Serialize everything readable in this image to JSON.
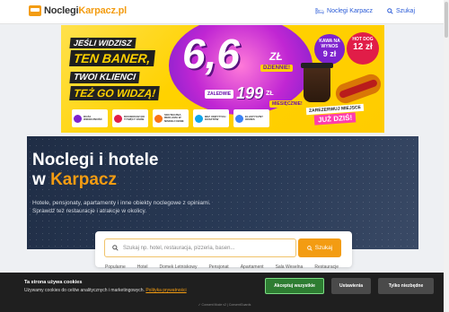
{
  "header": {
    "logo_prefix": "Noclegi",
    "logo_suffix": "Karpacz.pl",
    "nav": [
      {
        "label": "Noclegi Karpacz",
        "icon": "bed-icon"
      },
      {
        "label": "Szukaj",
        "icon": "search-icon"
      }
    ]
  },
  "banner": {
    "line1": "JEŚLI WIDZISZ",
    "line2": "TEN BANER,",
    "line3": "TWOI KLIENCI",
    "line4": "TEŻ GO WIDZĄ!",
    "price": "6,6",
    "price_unit": "ZŁ",
    "daily_label": "DZIENNIE!",
    "only_label": "ZALEDWIE",
    "monthly_price": "199",
    "monthly_unit": "ZŁ",
    "monthly_label": "MIESIĘCZNIE!",
    "kawa_label": "KAWA NA WYNOS",
    "kawa_price": "9 zł",
    "hotdog_label": "HOT DOG",
    "hotdog_price": "12 zł",
    "reserve_label": "ZAREZERWUJ MIEJSCE",
    "reserve_cta": "JUŻ DZIŚ!",
    "features": [
      {
        "text": "DUŻA WIDOCZNOŚĆ",
        "color": "#7e22ce"
      },
      {
        "text": "DOCIERASZ DO TYSIĘCY OSÓB",
        "color": "#e11d48"
      },
      {
        "text": "SKUTECZNA REKLAMA W NISKIEJ CENIE",
        "color": "#f97316"
      },
      {
        "text": "BEZ UKRYTYCH KOSZTÓW",
        "color": "#0ea5e9"
      },
      {
        "text": "ELASTYCZNY OKRES",
        "color": "#3b82f6"
      }
    ]
  },
  "hero": {
    "title_line1": "Noclegi i hotele",
    "title_w": "w",
    "title_city": "Karpacz",
    "desc_line1": "Hotele, pensjonaty, apartamenty i inne obiekty noclegowe z opiniami.",
    "desc_line2": "Sprawdź też restauracje i atrakcje w okolicy."
  },
  "search": {
    "placeholder": "Szukaj np. hotel, restauracja, pizzeria, basen...",
    "button_label": "Szukaj"
  },
  "categories": [
    "Popularne",
    "Hotel",
    "Domek Letniskowy",
    "Pensjonat",
    "Apartament",
    "Sala Weselna",
    "Restauracje"
  ],
  "cookie": {
    "title": "Ta strona używa cookies",
    "text": "Używamy cookies do celów analitycznych i marketingowych.",
    "link": "Polityka prywatności",
    "accept": "Akceptuj wszystkie",
    "settings": "Ustawienia",
    "necessary": "Tylko niezbędne",
    "footer": "✓ Consent Mode v2 | ConsentGuards"
  }
}
